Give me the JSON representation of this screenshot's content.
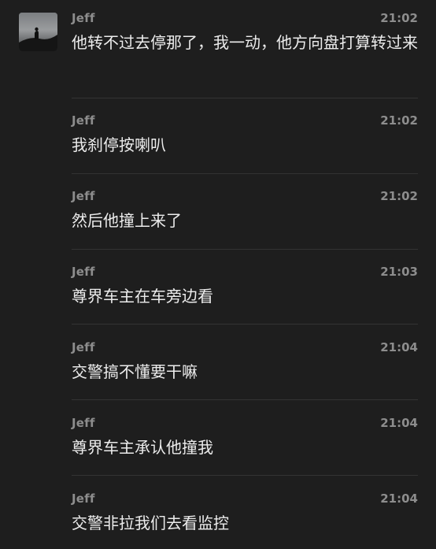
{
  "messages": [
    {
      "sender": "Jeff",
      "time": "21:02",
      "text": "他转不过去停那了，我一动，他方向盘打算转过来"
    },
    {
      "sender": "Jeff",
      "time": "21:02",
      "text": "我刹停按喇叭"
    },
    {
      "sender": "Jeff",
      "time": "21:02",
      "text": "然后他撞上来了"
    },
    {
      "sender": "Jeff",
      "time": "21:03",
      "text": "尊界车主在车旁边看"
    },
    {
      "sender": "Jeff",
      "time": "21:04",
      "text": "交警搞不懂要干嘛"
    },
    {
      "sender": "Jeff",
      "time": "21:04",
      "text": "尊界车主承认他撞我"
    },
    {
      "sender": "Jeff",
      "time": "21:04",
      "text": "交警非拉我们去看监控"
    }
  ],
  "colors": {
    "background": "#1e1e1e",
    "meta_text": "#8d8d8d",
    "body_text": "#ececec",
    "divider": "#333333"
  }
}
